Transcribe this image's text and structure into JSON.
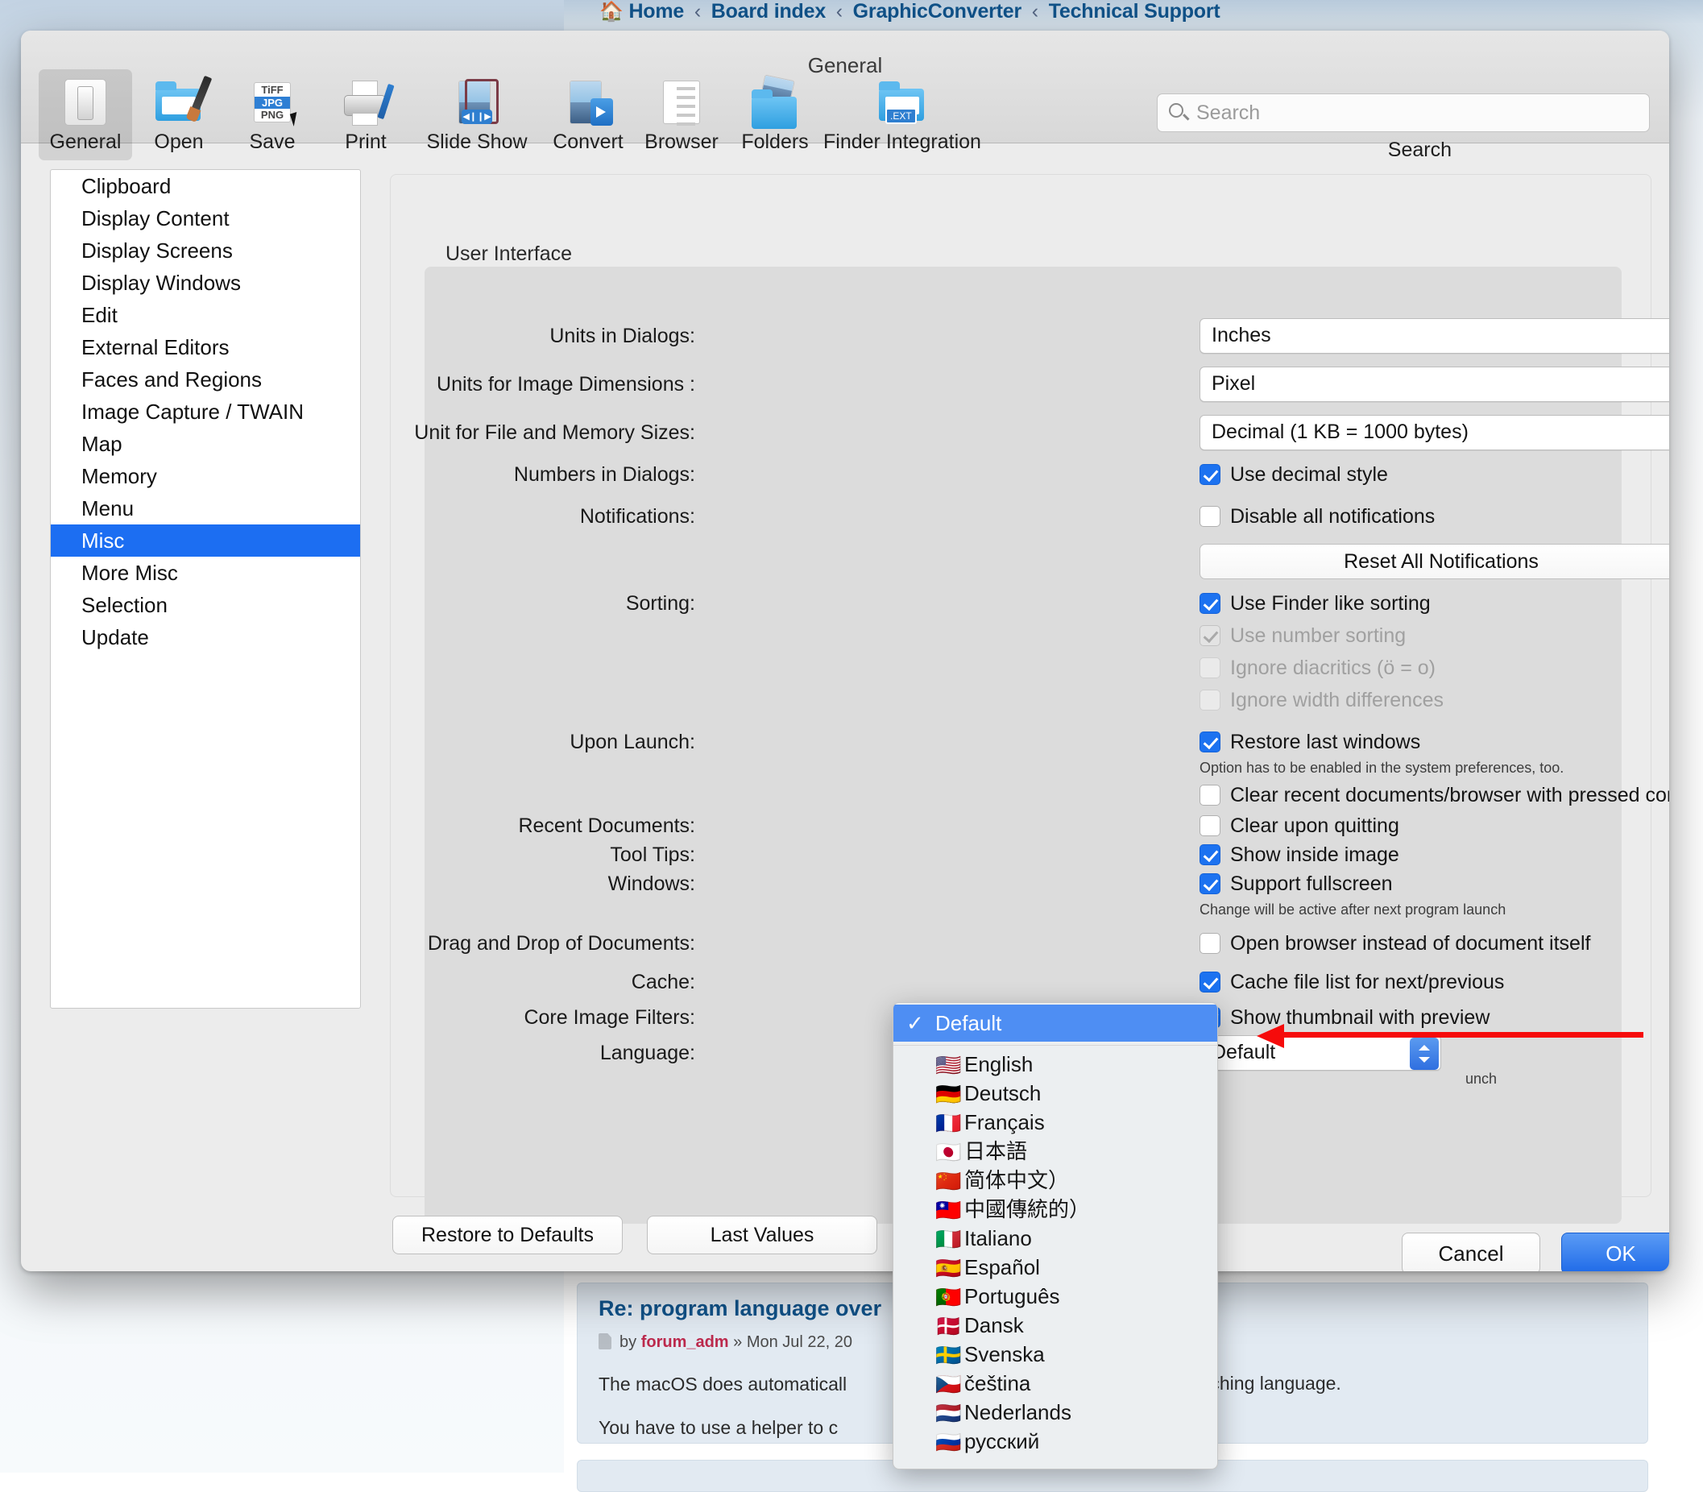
{
  "background": {
    "breadcrumb": {
      "home_icon": "home-icon",
      "items": [
        "Home",
        "Board index",
        "GraphicConverter",
        "Technical Support"
      ],
      "separator": "‹"
    },
    "post": {
      "title": "Re: program language over",
      "by_prefix": "by",
      "author": "forum_adm",
      "date_prefix": "» Mon Jul 22, 20",
      "paragraph1_left": "The macOS does automaticall",
      "paragraph1_right": "tching language.",
      "paragraph2_left": "You have to use a helper to c",
      "paragraph2_right": "."
    }
  },
  "dialog": {
    "title": "General",
    "toolbar": {
      "items": [
        {
          "label": "General",
          "icon": "switch-icon",
          "selected": true
        },
        {
          "label": "Open",
          "icon": "folder-brush-icon",
          "selected": false
        },
        {
          "label": "Save",
          "icon": "file-formats-icon",
          "selected": false
        },
        {
          "label": "Print",
          "icon": "printer-icon",
          "selected": false
        },
        {
          "label": "Slide Show",
          "icon": "slideshow-icon",
          "selected": false
        },
        {
          "label": "Convert",
          "icon": "convert-icon",
          "selected": false
        },
        {
          "label": "Browser",
          "icon": "browser-list-icon",
          "selected": false
        },
        {
          "label": "Folders",
          "icon": "folders-photos-icon",
          "selected": false
        },
        {
          "label": "Finder Integration",
          "icon": "finder-ext-icon",
          "selected": false
        }
      ],
      "icon_text": {
        "tiff": "TiFF",
        "jpg": "JPG",
        "png": "PNG",
        "ext": ".EXT"
      }
    },
    "search": {
      "placeholder": "Search",
      "value": "",
      "icon": "search-icon",
      "label": "Search"
    },
    "sidebar": {
      "items": [
        {
          "label": "Clipboard",
          "active": false
        },
        {
          "label": "Display Content",
          "active": false
        },
        {
          "label": "Display Screens",
          "active": false
        },
        {
          "label": "Display Windows",
          "active": false
        },
        {
          "label": "Edit",
          "active": false
        },
        {
          "label": "External Editors",
          "active": false
        },
        {
          "label": "Faces and Regions",
          "active": false
        },
        {
          "label": "Image Capture / TWAIN",
          "active": false
        },
        {
          "label": "Map",
          "active": false
        },
        {
          "label": "Memory",
          "active": false
        },
        {
          "label": "Menu",
          "active": false
        },
        {
          "label": "Misc",
          "active": true
        },
        {
          "label": "More Misc",
          "active": false
        },
        {
          "label": "Selection",
          "active": false
        },
        {
          "label": "Update",
          "active": false
        }
      ]
    },
    "settings": {
      "group_title": "User Interface",
      "rows": {
        "units_in_dialogs": {
          "label": "Units in Dialogs:",
          "value": "Inches"
        },
        "units_image_dimensions": {
          "label": "Units for Image Dimensions :",
          "value": "Pixel"
        },
        "unit_file_memory": {
          "label": "Unit for File and Memory Sizes:",
          "value": "Decimal (1 KB = 1000 bytes)"
        },
        "numbers_in_dialogs": {
          "label": "Numbers in Dialogs:",
          "checkbox": "Use decimal style",
          "checked": true
        },
        "notifications": {
          "label": "Notifications:",
          "checkbox": "Disable all notifications",
          "checked": false
        },
        "reset_notifications_button": "Reset All Notifications",
        "sorting": {
          "label": "Sorting:",
          "options": [
            {
              "text": "Use Finder like sorting",
              "checked": true,
              "disabled": false
            },
            {
              "text": "Use number sorting",
              "checked": true,
              "disabled": true
            },
            {
              "text": "Ignore diacritics (ö = o)",
              "checked": false,
              "disabled": true
            },
            {
              "text": "Ignore width differences",
              "checked": false,
              "disabled": true
            }
          ]
        },
        "upon_launch": {
          "label": "Upon Launch:",
          "checkbox": "Restore last windows",
          "checked": true,
          "hint": "Option has to be enabled in the system preferences, too.",
          "second_checkbox": "Clear recent documents/browser with pressed command key",
          "second_checked": false
        },
        "recent_documents": {
          "label": "Recent Documents:",
          "checkbox": "Clear upon quitting",
          "checked": false
        },
        "tool_tips": {
          "label": "Tool Tips:",
          "checkbox": "Show inside image",
          "checked": true
        },
        "windows": {
          "label": "Windows:",
          "checkbox": "Support fullscreen",
          "checked": true,
          "hint": "Change will be active after next program launch"
        },
        "drag_and_drop": {
          "label": "Drag and Drop of Documents:",
          "checkbox": "Open browser instead of document itself",
          "checked": false
        },
        "cache": {
          "label": "Cache:",
          "checkbox": "Cache file list for next/previous",
          "checked": true
        },
        "core_image_filters": {
          "label": "Core Image Filters:",
          "checkbox": "Show thumbnail with preview",
          "checked": true
        },
        "language": {
          "label": "Language:",
          "value": "Default",
          "hint_tail": "unch"
        }
      },
      "restore_to_defaults_button": "Restore to Defaults",
      "last_values_button": "Last Values"
    },
    "footer": {
      "cancel_button": "Cancel",
      "ok_button": "OK"
    }
  },
  "language_menu": {
    "selected": "Default",
    "check_glyph": "✓",
    "items": [
      {
        "label": "Default",
        "flag": "",
        "selected": true
      },
      {
        "label": "English",
        "flag": "🇺🇸",
        "selected": false
      },
      {
        "label": "Deutsch",
        "flag": "🇩🇪",
        "selected": false
      },
      {
        "label": "Français",
        "flag": "🇫🇷",
        "selected": false
      },
      {
        "label": "日本語",
        "flag": "🇯🇵",
        "selected": false
      },
      {
        "label": "简体中文）",
        "flag": "🇨🇳",
        "selected": false
      },
      {
        "label": "中國傳統的）",
        "flag": "🇹🇼",
        "selected": false
      },
      {
        "label": "Italiano",
        "flag": "🇮🇹",
        "selected": false
      },
      {
        "label": "Español",
        "flag": "🇪🇸",
        "selected": false
      },
      {
        "label": "Português",
        "flag": "🇵🇹",
        "selected": false
      },
      {
        "label": "Dansk",
        "flag": "🇩🇰",
        "selected": false
      },
      {
        "label": "Svenska",
        "flag": "🇸🇪",
        "selected": false
      },
      {
        "label": "čeština",
        "flag": "🇨🇿",
        "selected": false
      },
      {
        "label": "Nederlands",
        "flag": "🇳🇱",
        "selected": false
      },
      {
        "label": "русский",
        "flag": "🇷🇺",
        "selected": false
      }
    ]
  },
  "annotation": {
    "arrow": "red-left-arrow",
    "color": "#f60b0b"
  }
}
